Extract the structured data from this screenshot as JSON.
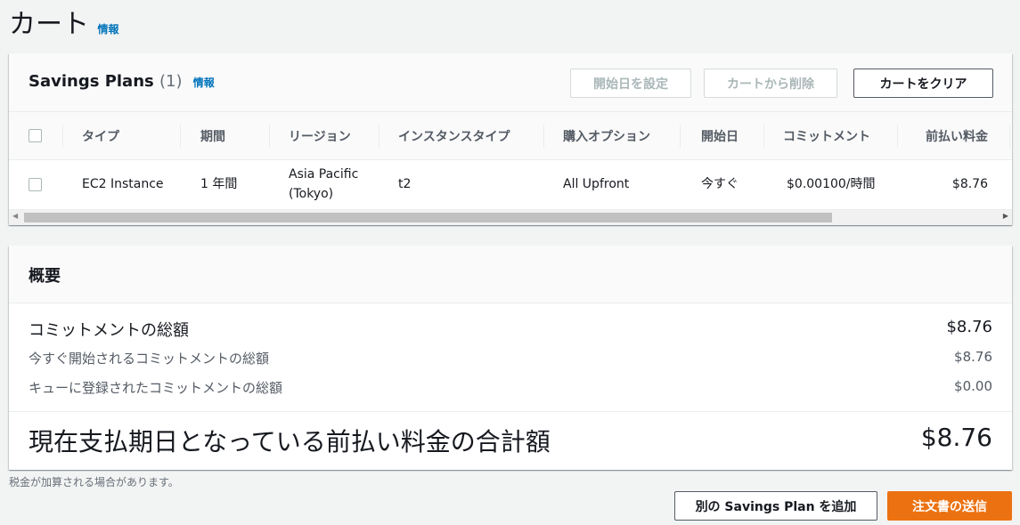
{
  "page": {
    "title": "カート",
    "info": "情報"
  },
  "plans": {
    "title": "Savings Plans",
    "count": "(1)",
    "info": "情報",
    "buttons": {
      "set_start": "開始日を設定",
      "remove": "カートから削除",
      "clear": "カートをクリア"
    },
    "columns": [
      "タイプ",
      "期間",
      "リージョン",
      "インスタンスタイプ",
      "購入オプション",
      "開始日",
      "コミットメント",
      "前払い料金"
    ],
    "rows": [
      {
        "type": "EC2 Instance",
        "term": "1 年間",
        "region_line1": "Asia Pacific",
        "region_line2": "(Tokyo)",
        "instance_type": "t2",
        "purchase_option": "All Upfront",
        "start": "今すぐ",
        "commitment": "$0.00100/時間",
        "upfront": "$8.76"
      }
    ]
  },
  "summary": {
    "title": "概要",
    "total_commit_label": "コミットメントの総額",
    "total_commit": "$8.76",
    "now_label": "今すぐ開始されるコミットメントの総額",
    "now": "$8.76",
    "queued_label": "キューに登録されたコミットメントの総額",
    "queued": "$0.00",
    "due_label": "現在支払期日となっている前払い料金の合計額",
    "due": "$8.76"
  },
  "footer": {
    "tax_note": "税金が加算される場合があります。",
    "add_plan": "別の Savings Plan を追加",
    "submit": "注文書の送信"
  }
}
